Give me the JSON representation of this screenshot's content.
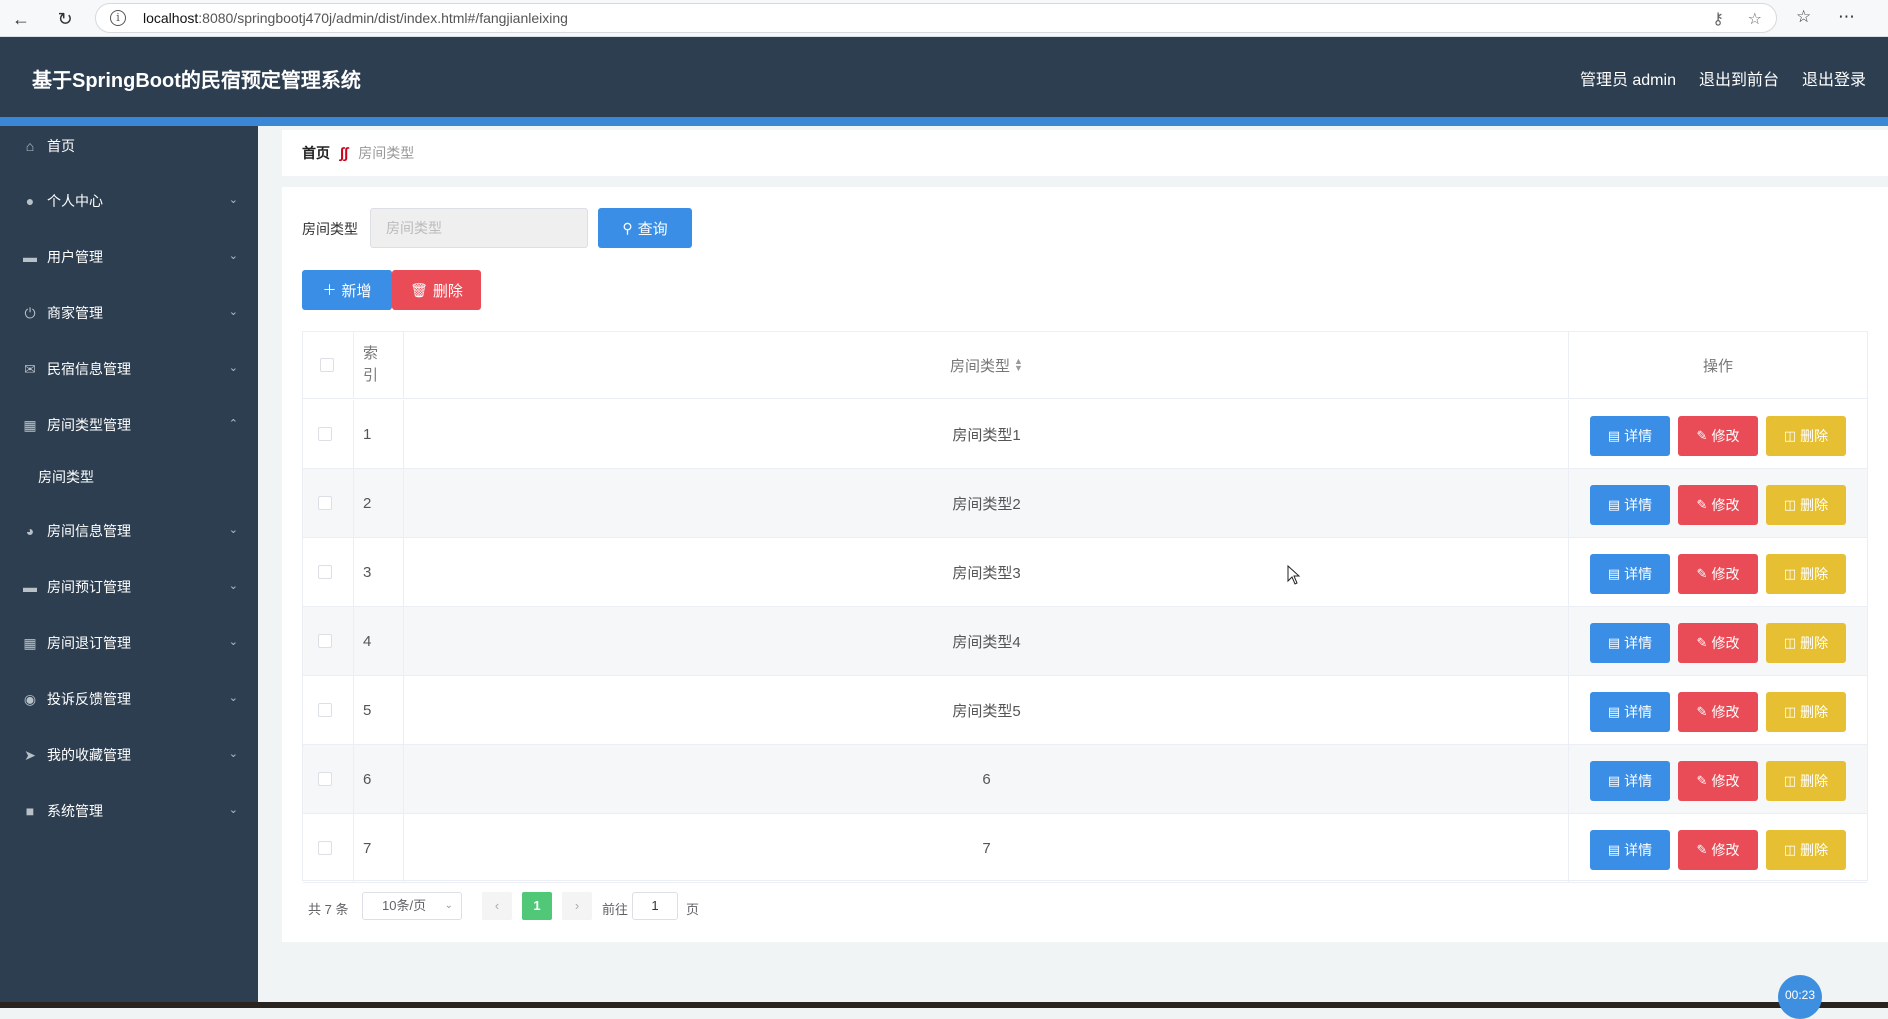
{
  "browser": {
    "url_host": "localhost",
    "url_rest": ":8080/springbootj470j/admin/dist/index.html#/fangjianleixing"
  },
  "header": {
    "title": "基于SpringBoot的民宿预定管理系统",
    "user": "管理员 admin",
    "to_front": "退出到前台",
    "logout": "退出登录"
  },
  "sidebar": {
    "items": [
      {
        "label": "首页",
        "icon": "home-icon"
      },
      {
        "label": "个人中心",
        "icon": "user-icon"
      },
      {
        "label": "用户管理",
        "icon": "monitor-icon"
      },
      {
        "label": "商家管理",
        "icon": "power-icon"
      },
      {
        "label": "民宿信息管理",
        "icon": "mail-icon"
      },
      {
        "label": "房间类型管理",
        "icon": "bar-chart-icon"
      },
      {
        "label": "房间信息管理",
        "icon": "compass-icon"
      },
      {
        "label": "房间预订管理",
        "icon": "monitor-icon"
      },
      {
        "label": "房间退订管理",
        "icon": "grid-icon"
      },
      {
        "label": "投诉反馈管理",
        "icon": "bell-off-icon"
      },
      {
        "label": "我的收藏管理",
        "icon": "send-icon"
      },
      {
        "label": "系统管理",
        "icon": "device-icon"
      }
    ],
    "sub_item": "房间类型"
  },
  "breadcrumb": {
    "home": "首页",
    "current": "房间类型"
  },
  "search": {
    "label": "房间类型",
    "placeholder": "房间类型",
    "button": "查询"
  },
  "toolbar": {
    "add": "新增",
    "delete": "删除"
  },
  "table": {
    "col_index": "索引",
    "col_type": "房间类型",
    "col_ops": "操作",
    "rows": [
      {
        "index": "1",
        "type": "房间类型1"
      },
      {
        "index": "2",
        "type": "房间类型2"
      },
      {
        "index": "3",
        "type": "房间类型3"
      },
      {
        "index": "4",
        "type": "房间类型4"
      },
      {
        "index": "5",
        "type": "房间类型5"
      },
      {
        "index": "6",
        "type": "6"
      },
      {
        "index": "7",
        "type": "7"
      }
    ],
    "btn_detail": "详情",
    "btn_edit": "修改",
    "btn_delete": "删除"
  },
  "pagination": {
    "total": "共 7 条",
    "page_size": "10条/页",
    "current_page": "1",
    "goto_label": "前往",
    "goto_value": "1",
    "page_unit": "页"
  },
  "timer": "00:23",
  "colors": {
    "header_bg": "#2c3e50",
    "accent_blue": "#3a8ee6",
    "danger_red": "#e94c57",
    "warning_yellow": "#e6c032",
    "page_active": "#50c878"
  }
}
